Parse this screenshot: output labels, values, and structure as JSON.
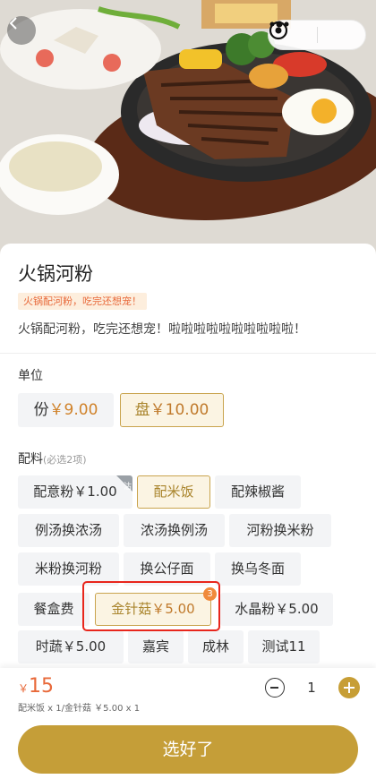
{
  "product": {
    "name": "火锅河粉",
    "tag": "火锅配河粉，吃完还想宠！",
    "description": "火锅配河粉，吃完还想宠！啦啦啦啦啦啦啦啦啦啦！"
  },
  "units": {
    "label": "单位",
    "options": [
      {
        "name": "份",
        "price": "￥9.00",
        "selected": false
      },
      {
        "name": "盘",
        "price": "￥10.00",
        "selected": true
      }
    ]
  },
  "addons": {
    "label": "配料",
    "hint": "(必选2项)",
    "items": [
      {
        "name": "配意粉",
        "price": "￥1.00",
        "selected": false,
        "corner_tag": "沽"
      },
      {
        "name": "配米饭",
        "price": "",
        "selected": true
      },
      {
        "name": "配辣椒酱",
        "price": "",
        "selected": false
      },
      {
        "name": "例汤换浓汤",
        "price": "",
        "selected": false
      },
      {
        "name": "浓汤换例汤",
        "price": "",
        "selected": false
      },
      {
        "name": "河粉换米粉",
        "price": "",
        "selected": false
      },
      {
        "name": "米粉换河粉",
        "price": "",
        "selected": false
      },
      {
        "name": "换公仔面",
        "price": "",
        "selected": false
      },
      {
        "name": "换乌冬面",
        "price": "",
        "selected": false
      },
      {
        "name": "餐盒费",
        "price": "",
        "selected": false
      },
      {
        "name": "金针菇",
        "price": "￥5.00",
        "selected": true,
        "badge": "3"
      },
      {
        "name": "水晶粉",
        "price": "￥5.00",
        "selected": false
      },
      {
        "name": "时蔬",
        "price": "￥5.00",
        "selected": false
      },
      {
        "name": "嘉宾",
        "price": "",
        "selected": false
      },
      {
        "name": "成林",
        "price": "",
        "selected": false
      },
      {
        "name": "测试11",
        "price": "",
        "selected": false
      }
    ]
  },
  "footer": {
    "currency": "￥",
    "total": "15",
    "summary": "配米饭 x 1/金针菇 ￥5.00 x 1",
    "quantity": "1",
    "confirm_label": "选好了"
  },
  "colors": {
    "accent": "#c59e38",
    "price": "#d0822a",
    "highlight": "#e8261c"
  },
  "icons": [
    "back-icon",
    "more-icon",
    "close-capsule-icon",
    "minus-icon",
    "plus-icon"
  ]
}
